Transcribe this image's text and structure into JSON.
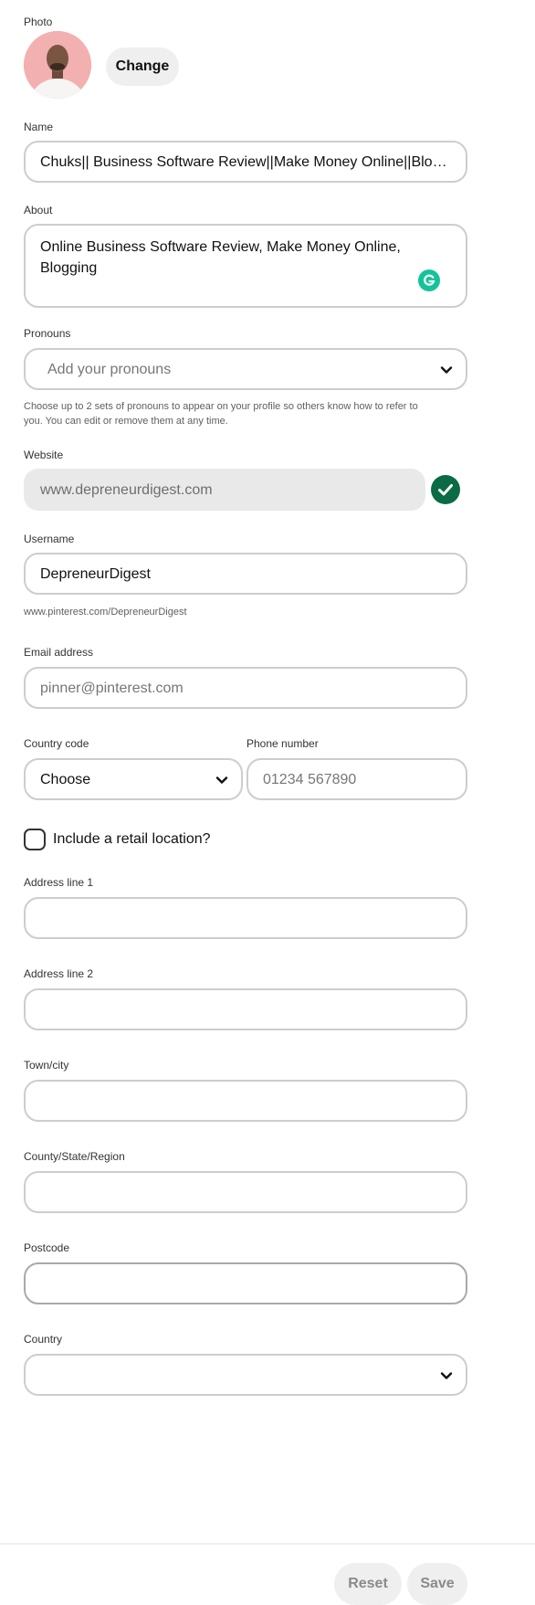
{
  "photo": {
    "label": "Photo",
    "change_label": "Change"
  },
  "name": {
    "label": "Name",
    "value": "Chuks|| Business Software Review||Make Money Online||Bloggi..."
  },
  "about": {
    "label": "About",
    "value_line1": "Online Business Software Review, Make Money Online,",
    "value_line2": "Blogging"
  },
  "pronouns": {
    "label": "Pronouns",
    "placeholder": "Add your pronouns",
    "help_line1": "Choose up to 2 sets of pronouns to appear on your profile so others know how to refer to",
    "help_line2": "you. You can edit or remove them at any time."
  },
  "website": {
    "label": "Website",
    "value": "www.depreneurdigest.com"
  },
  "username": {
    "label": "Username",
    "value": "DepreneurDigest",
    "url": "www.pinterest.com/DepreneurDigest"
  },
  "email": {
    "label": "Email address",
    "placeholder": "pinner@pinterest.com"
  },
  "country_code": {
    "label": "Country code",
    "value": "Choose"
  },
  "phone": {
    "label": "Phone number",
    "placeholder": "01234 567890"
  },
  "retail": {
    "label": "Include a retail location?"
  },
  "address1": {
    "label": "Address line 1",
    "value": ""
  },
  "address2": {
    "label": "Address line 2",
    "value": ""
  },
  "town": {
    "label": "Town/city",
    "value": ""
  },
  "county": {
    "label": "County/State/Region",
    "value": ""
  },
  "postcode": {
    "label": "Postcode",
    "value": ""
  },
  "country": {
    "label": "Country",
    "value": ""
  },
  "footer": {
    "reset_label": "Reset",
    "save_label": "Save"
  },
  "colors": {
    "verified_green": "#0a6b45",
    "grammarly_green": "#15c39a",
    "pill_grey": "#efefef",
    "field_border": "#cdcdcd"
  },
  "icons": [
    "avatar-photo",
    "chevron-down-icon",
    "check-circle-icon",
    "grammarly-icon",
    "checkbox-icon"
  ]
}
